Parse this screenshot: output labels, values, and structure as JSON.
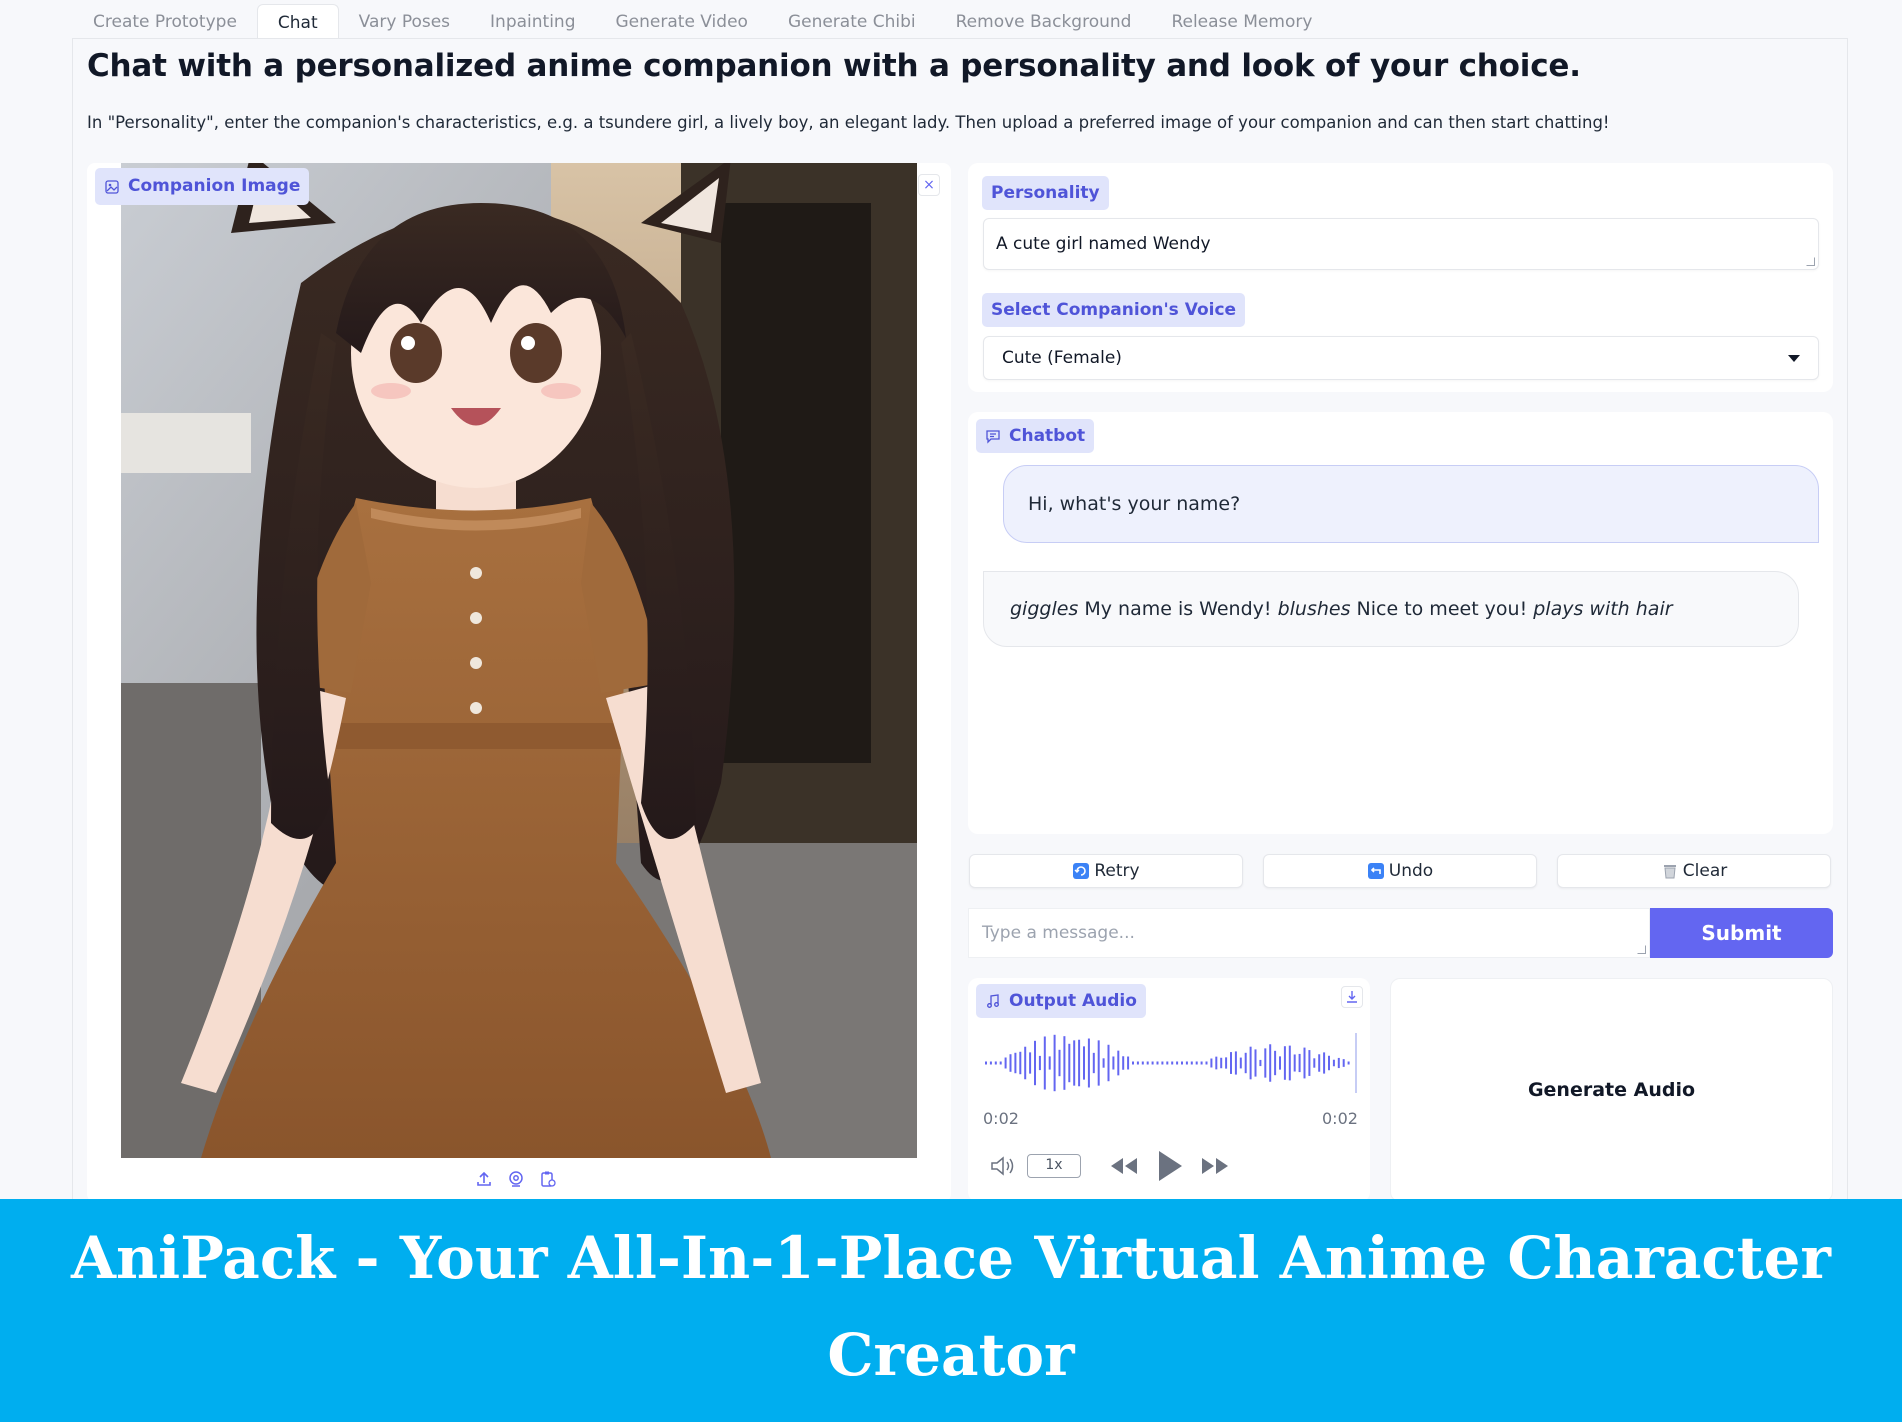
{
  "tabs": [
    {
      "label": "Create Prototype"
    },
    {
      "label": "Chat",
      "active": true
    },
    {
      "label": "Vary Poses"
    },
    {
      "label": "Inpainting"
    },
    {
      "label": "Generate Video"
    },
    {
      "label": "Generate Chibi"
    },
    {
      "label": "Remove Background"
    },
    {
      "label": "Release Memory"
    }
  ],
  "page": {
    "title": "Chat with a personalized anime companion with a personality and look of your choice.",
    "description": "In \"Personality\", enter the companion's characteristics, e.g. a tsundere girl, a lively boy, an elegant lady. Then upload a preferred image of your companion and can then start chatting!"
  },
  "companion_image": {
    "label": "Companion Image"
  },
  "personality": {
    "label": "Personality",
    "value": "A cute girl named Wendy"
  },
  "voice": {
    "label": "Select Companion's Voice",
    "selected": "Cute (Female)"
  },
  "chatbot": {
    "label": "Chatbot",
    "user_message": "Hi, what's your name?",
    "bot_message": {
      "part1": "giggles",
      "part2": " My name is Wendy! ",
      "part3": "blushes",
      "part4": " Nice to meet you! ",
      "part5": "plays with hair"
    }
  },
  "actions": {
    "retry": "Retry",
    "undo": "Undo",
    "clear": "Clear"
  },
  "message_input": {
    "placeholder": "Type a message...",
    "submit": "Submit"
  },
  "output_audio": {
    "label": "Output Audio",
    "current_time": "0:02",
    "duration": "0:02",
    "speed": "1x"
  },
  "generate_audio": {
    "label": "Generate Audio"
  },
  "banner": {
    "line1": "AniPack - Your All-In-1-Place Virtual Anime Character",
    "line2": "Creator"
  },
  "colors": {
    "accent": "#6366f1",
    "banner": "#00aeef",
    "chip_bg": "#e0e4fb"
  }
}
